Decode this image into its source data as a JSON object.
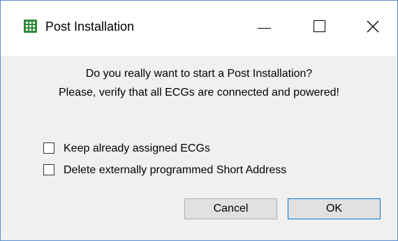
{
  "window": {
    "title": "Post Installation",
    "app_icon": "green-grid-app-icon",
    "caption_buttons": {
      "minimize": "minimize-icon",
      "maximize": "maximize-icon",
      "close": "close-icon"
    }
  },
  "dialog": {
    "message_line1": "Do you really want to start a Post Installation?",
    "message_line2": "Please, verify that all ECGs are connected and powered!",
    "options": [
      {
        "label": "Keep already assigned ECGs",
        "checked": false
      },
      {
        "label": "Delete externally programmed Short Address",
        "checked": false
      }
    ],
    "cancel_label": "Cancel",
    "ok_label": "OK"
  },
  "colors": {
    "accent": "#0078d7",
    "icon_green": "#2f8a3a",
    "window_border": "#5a8fd0",
    "dialog_bg": "#f0f0f0"
  }
}
